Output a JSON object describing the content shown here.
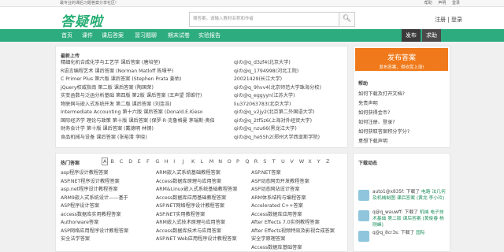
{
  "topbar": {
    "slogan": "最专业的课后习题答案分享社区!",
    "links": [
      "帮助",
      "声明",
      "登录"
    ]
  },
  "header": {
    "logo": "答疑啦",
    "search_placeholder": "搜答案，请输入教材名称和作者",
    "search_icon": "search-icon",
    "auth": "注册 | 登录"
  },
  "nav": {
    "items": [
      "首页",
      "课件",
      "课后答案",
      "習习题聊",
      "期末试卷",
      "实验报告"
    ],
    "right": [
      "发布",
      "求助"
    ]
  },
  "uploads": {
    "title": "最新上传",
    "rows": [
      {
        "left": "精细化机合成化学与工艺学 课后答案 (唐培堃)",
        "right": "qiの@q_d3zf4(北京大学)"
      },
      {
        "left": "R语言编程艺术 课后答案 (Norman Matloff 陈堰平)",
        "right": "qiの@q_1794998(河北工院)"
      },
      {
        "left": "C Primer Plus 第六版 课后答案 (Stephen Prata 姜佑)",
        "right": "20021429(长江大学)"
      },
      {
        "left": "jQuery权威指南 第二版 课后答案 (陶国荣)",
        "right": "qiの@q_9hvv4(北京师范大学珠海分校)"
      },
      {
        "left": "实变函数与泛函分析基础 第四版 第2版 课后答案 (王声望 郑维行)",
        "right": "qiの@q_eggyyn(江苏大学)"
      },
      {
        "left": "物联网与嵌入式系统开发 第二版 课后答案 (刘连浩)",
        "right": "liu372063783(北京大学)"
      },
      {
        "left": "Intermediate Accounting 第十六版 课后答案 (Donald.E.Kieso",
        "right": "qiの@q_v2jy2(北京第二外国语大学)"
      },
      {
        "left": "国际经济学 理论与政策 第十版 课后答案 (保罗·R·克鲁格曼 茅瑞斯·奥伯",
        "right": "qiの@q_2tf5z6(上海对外经贸大学)"
      },
      {
        "left": "财务会计学 第十版 课后答案 (戴德明 林钢)",
        "right": "qiの@q_nzu66(黑龙江大学)"
      },
      {
        "left": "食品机械与设备 课后答案 (张裕清 李晓)",
        "right": "qiの@q_he55h2(郑州大学西亚斯学院)"
      }
    ]
  },
  "hot": {
    "title": "热门答案",
    "letters": [
      "A",
      "B",
      "C",
      "D",
      "E",
      "F",
      "G",
      "H",
      "I",
      "J",
      "K",
      "L",
      "M",
      "N",
      "O",
      "P",
      "Q",
      "R",
      "S",
      "T",
      "U",
      "V",
      "W",
      "X",
      "Y",
      "Z"
    ],
    "selected": "A",
    "cols": [
      [
        "asp程序设计教程答案",
        "ASP.NET程序设计教程答案",
        "asp.net程序设计教程答案",
        "ARM9嵌入式系统设计——基于",
        "ASP程序设计答案",
        "access数据库实用教程答案",
        "Authorware答案",
        "ASP网络应用程序设计教程答案",
        "安全法学答案"
      ],
      [
        "ARM嵌入式系统基础教程答案",
        "Access数据库原理与应用答案",
        "ARM&Linux嵌入式系统基础教程答案",
        "Access数据库应用基础教程答案",
        "ASP.NET网络程序设计教程答案",
        "ASP.NET实用教程答案",
        "ARM嵌入式技术原理与应用答案",
        "Access数据库技术与应用答案",
        "ASP.NET Web应用程序设计教程答案"
      ],
      [
        "ASP.NET答案",
        "ASP动态网页开发教程答案",
        "ASP动态网站设计答案",
        "ARM体系结构与编程答案",
        "Accelerated C++答案",
        "Access数据库应用答案",
        "After Effects 7.0实例教程答案",
        "After Effects视频特效及影视合成答案",
        "安全学原理答案",
        "Access数据库基础答案"
      ]
    ]
  },
  "post": {
    "title": "发布答案",
    "sub": "发布答案，得欣赏上涨!"
  },
  "help": {
    "title": "帮助",
    "items": [
      "如何下载及打开文档?",
      "免责声明",
      "如何获得金币?",
      "如何注册、登录?",
      "如何获取答案积分学分?",
      "意想下载声明"
    ]
  },
  "dynamics": {
    "title": "下载动态",
    "items": [
      {
        "user": "auto1@x835f:",
        "text": "下载了",
        "link": "电路 法几何及机械制图 课后答案 (黄龙 李小玲)"
      },
      {
        "user": "q@q_wauwff:",
        "text": "下载了",
        "link": "机械 电子技术基础 第二版 课后答案 (黄俊春 杨刚峰)"
      },
      {
        "user": "q@q_8cr3s:",
        "text": "下载了",
        "link": "国际"
      }
    ]
  },
  "colors": {
    "brand": "#2dac7f",
    "accent": "#f07a1b"
  }
}
